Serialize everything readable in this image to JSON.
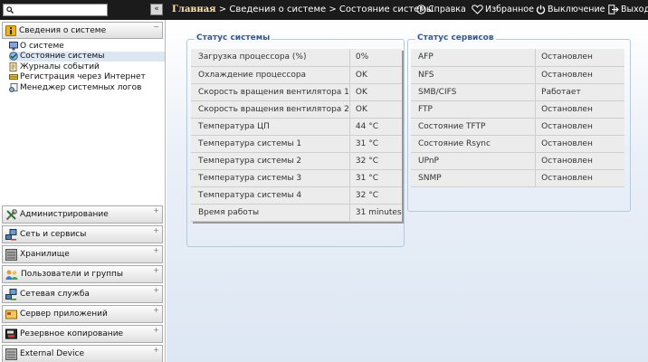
{
  "header": {
    "search": {
      "placeholder": "",
      "value": ""
    },
    "collapse_label": "«",
    "breadcrumb": {
      "home": "Главная",
      "sep1": ">",
      "level1": "Сведения о системе",
      "sep2": ">",
      "current": "Состояние системы"
    },
    "menu": {
      "help": "Справка",
      "favorites": "Избранное",
      "shutdown": "Выключение",
      "logout": "Выход"
    }
  },
  "sidebar": {
    "open_section": {
      "label": "Сведения о системе",
      "toggle": "−",
      "items": [
        {
          "label": "О системе",
          "icon": "monitor-icon"
        },
        {
          "label": "Состояние системы",
          "icon": "status-icon"
        },
        {
          "label": "Журналы событий",
          "icon": "log-icon"
        },
        {
          "label": "Регистрация через Интернет",
          "icon": "registration-icon"
        },
        {
          "label": "Менеджер системных логов",
          "icon": "syslog-icon"
        }
      ]
    },
    "sections": [
      {
        "label": "Администрирование",
        "toggle": "+",
        "icon": "tools-icon"
      },
      {
        "label": "Сеть и сервисы",
        "toggle": "+",
        "icon": "network-icon"
      },
      {
        "label": "Хранилище",
        "toggle": "+",
        "icon": "storage-icon"
      },
      {
        "label": "Пользователи и группы",
        "toggle": "+",
        "icon": "users-icon"
      },
      {
        "label": "Сетевая служба",
        "toggle": "+",
        "icon": "network-service-icon"
      },
      {
        "label": "Сервер приложений",
        "toggle": "+",
        "icon": "app-server-icon"
      },
      {
        "label": "Резервное копирование",
        "toggle": "+",
        "icon": "backup-icon"
      },
      {
        "label": "External Device",
        "toggle": "+",
        "icon": "external-device-icon"
      }
    ]
  },
  "system_status": {
    "title": "Статус системы",
    "rows": [
      {
        "label": "Загрузка процессора (%)",
        "value": "0%"
      },
      {
        "label": "Охлаждение процессора",
        "value": "OK"
      },
      {
        "label": "Скорость вращения вентилятора 1",
        "value": "OK"
      },
      {
        "label": "Скорость вращения вентилятора 2",
        "value": "OK"
      },
      {
        "label": "Температура ЦП",
        "value": "44 °C"
      },
      {
        "label": "Температура системы 1",
        "value": "31 °C"
      },
      {
        "label": "Температура системы 2",
        "value": "32 °C"
      },
      {
        "label": "Температура системы 3",
        "value": "31 °C"
      },
      {
        "label": "Температура системы 4",
        "value": "32 °C"
      },
      {
        "label": "Время работы",
        "value": "31 minutes"
      }
    ]
  },
  "service_status": {
    "title": "Статус сервисов",
    "rows": [
      {
        "label": "AFP",
        "value": "Остановлен",
        "state": "stopped"
      },
      {
        "label": "NFS",
        "value": "Остановлен",
        "state": "stopped"
      },
      {
        "label": "SMB/CIFS",
        "value": "Работает",
        "state": "running"
      },
      {
        "label": "FTP",
        "value": "Остановлен",
        "state": "stopped"
      },
      {
        "label": "Состояние TFTP",
        "value": "Остановлен",
        "state": "stopped"
      },
      {
        "label": "Состояние Rsync",
        "value": "Остановлен",
        "state": "stopped"
      },
      {
        "label": "UPnP",
        "value": "Остановлен",
        "state": "stopped"
      },
      {
        "label": "SNMP",
        "value": "Остановлен",
        "state": "stopped"
      }
    ]
  },
  "colors": {
    "stopped": "#e00000",
    "running": "#1a28c8",
    "topbar": "#1b1b1b"
  }
}
